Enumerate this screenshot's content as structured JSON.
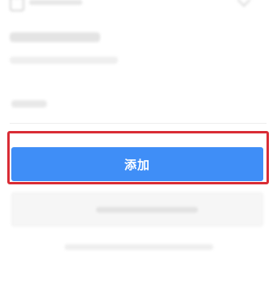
{
  "form": {
    "add_button_label": "添加"
  },
  "colors": {
    "primary_button": "#3f8ef7",
    "highlight_border": "#d92c35"
  }
}
